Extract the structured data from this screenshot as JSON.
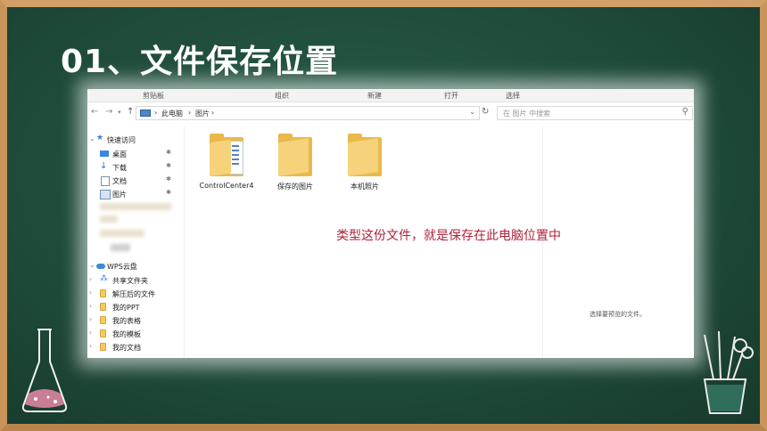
{
  "slide": {
    "title": "01、文件保存位置"
  },
  "explorer": {
    "ribbon": [
      "剪贴板",
      "组织",
      "新建",
      "打开",
      "选择"
    ],
    "address": {
      "crumbs": [
        "此电脑",
        "图片"
      ]
    },
    "search": {
      "placeholder": "在 图片 中搜索"
    },
    "sidebar": {
      "quick_access": "快速访问",
      "pinned": [
        {
          "label": "桌面",
          "icon": "desktop-icon"
        },
        {
          "label": "下载",
          "icon": "download-icon"
        },
        {
          "label": "文档",
          "icon": "document-icon"
        },
        {
          "label": "图片",
          "icon": "picture-icon"
        }
      ],
      "wps": "WPS云盘",
      "wps_items": [
        "共享文件夹",
        "解压后的文件",
        "我的PPT",
        "我的表格",
        "我的模板",
        "我的文档"
      ]
    },
    "files": [
      {
        "name": "ControlCenter4"
      },
      {
        "name": "保存的图片"
      },
      {
        "name": "本机照片"
      }
    ],
    "preview_text": "选择要预览的文件。"
  },
  "annotation": "类型这份文件，就是保存在此电脑位置中",
  "colors": {
    "board": "#1f4a3a",
    "frame": "#c9955a",
    "annotation": "#b0203a"
  }
}
